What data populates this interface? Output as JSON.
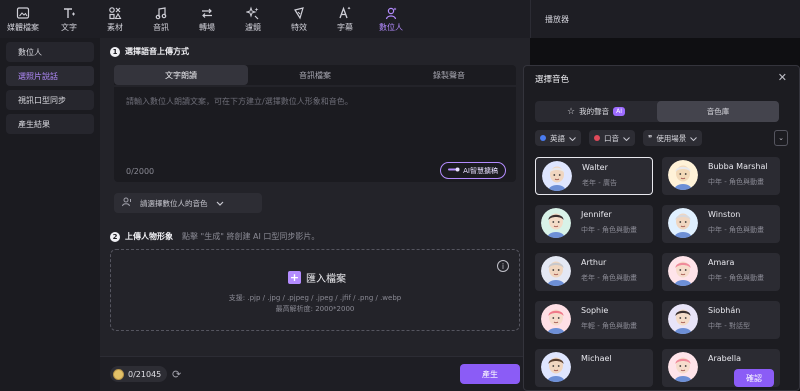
{
  "toolbar": {
    "items": [
      {
        "label": "媒體檔案",
        "icon": "media-icon"
      },
      {
        "label": "文字",
        "icon": "text-icon"
      },
      {
        "label": "素材",
        "icon": "elements-icon"
      },
      {
        "label": "音訊",
        "icon": "audio-icon"
      },
      {
        "label": "轉場",
        "icon": "transition-icon"
      },
      {
        "label": "濾鏡",
        "icon": "filter-icon"
      },
      {
        "label": "特效",
        "icon": "effects-icon"
      },
      {
        "label": "字幕",
        "icon": "subtitle-icon"
      },
      {
        "label": "數位人",
        "icon": "digital-human-icon"
      }
    ],
    "active_index": 8,
    "accent": "#b48cff"
  },
  "player": {
    "title": "播放器"
  },
  "sidebar": {
    "items": [
      {
        "label": "數位人"
      },
      {
        "label": "選照片說話"
      },
      {
        "label": "視訊口型同步"
      },
      {
        "label": "產生結果"
      }
    ],
    "active_index": 1
  },
  "step1": {
    "num": "1",
    "title": "選擇語音上傳方式",
    "tabs": [
      "文字朗讀",
      "音訊檔案",
      "錄製聲音"
    ],
    "active_tab": 0,
    "placeholder": "請輸入數位人朗讀文案，可在下方建立/選擇數位人形象和音色。",
    "char_count": "0/2000",
    "ai_button": "AI智慧擴稿",
    "voice_select": "請選擇數位人的音色"
  },
  "step2": {
    "num": "2",
    "title": "上傳人物形象",
    "hint": "點擊 \"生成\" 將創建 AI 口型同步影片。",
    "import_label": "匯入檔案",
    "support": "支援: .pjp / .jpg / .pjpeg / .jpeg / .jfif / .png / .webp",
    "max_res": "最高解析度: 2000*2000"
  },
  "bottom": {
    "credits": "0/21045",
    "generate": "產生"
  },
  "dialog": {
    "title": "選擇音色",
    "tabs": [
      {
        "label": "我的聲音",
        "badge": "AI"
      },
      {
        "label": "音色庫"
      }
    ],
    "active_tab": 1,
    "filters": [
      {
        "label": "英語",
        "dot": "#4a7cf0"
      },
      {
        "label": "口音",
        "dot": "#e04a5a"
      },
      {
        "label": "使用場景",
        "glyph": "❞"
      }
    ],
    "voices": [
      {
        "name": "Walter",
        "desc": "老年 - 廣告",
        "skin": "#f0d6c0",
        "hair": "#e8e8ec",
        "bg": "#dfe6ff",
        "selected": true
      },
      {
        "name": "Bubba Marshal",
        "desc": "中年 - 角色與動畫",
        "skin": "#f2d9b8",
        "hair": "#e8e8ec",
        "bg": "#fff2d8",
        "selected": false
      },
      {
        "name": "Jennifer",
        "desc": "中年 - 角色與動畫",
        "skin": "#f4dcc8",
        "hair": "#3a3030",
        "bg": "#d8f2e8",
        "selected": false
      },
      {
        "name": "Winston",
        "desc": "中年 - 角色與動畫",
        "skin": "#f0d6c0",
        "hair": "#d8d8dc",
        "bg": "#e0f0ff",
        "selected": false
      },
      {
        "name": "Arthur",
        "desc": "老年 - 角色與動畫",
        "skin": "#f0d6c0",
        "hair": "#c8c8cc",
        "bg": "#e4e8f4",
        "selected": false
      },
      {
        "name": "Amara",
        "desc": "中年 - 角色與動畫",
        "skin": "#f6dccc",
        "hair": "#f08a9a",
        "bg": "#ffe4ea",
        "selected": false
      },
      {
        "name": "Sophie",
        "desc": "年輕 - 角色與動畫",
        "skin": "#f6dccc",
        "hair": "#f07a8a",
        "bg": "#ffe0e6",
        "selected": false
      },
      {
        "name": "Siobhán",
        "desc": "中年 - 對話型",
        "skin": "#f4dcc8",
        "hair": "#3a3030",
        "bg": "#e8e4f8",
        "selected": false
      },
      {
        "name": "Michael",
        "desc": "",
        "skin": "#f0d6c0",
        "hair": "#5a4030",
        "bg": "#dfe6ff",
        "selected": false
      },
      {
        "name": "Arabella",
        "desc": "",
        "skin": "#f6dccc",
        "hair": "#f08a9a",
        "bg": "#ffe4ea",
        "selected": false
      }
    ],
    "confirm": "確認"
  }
}
